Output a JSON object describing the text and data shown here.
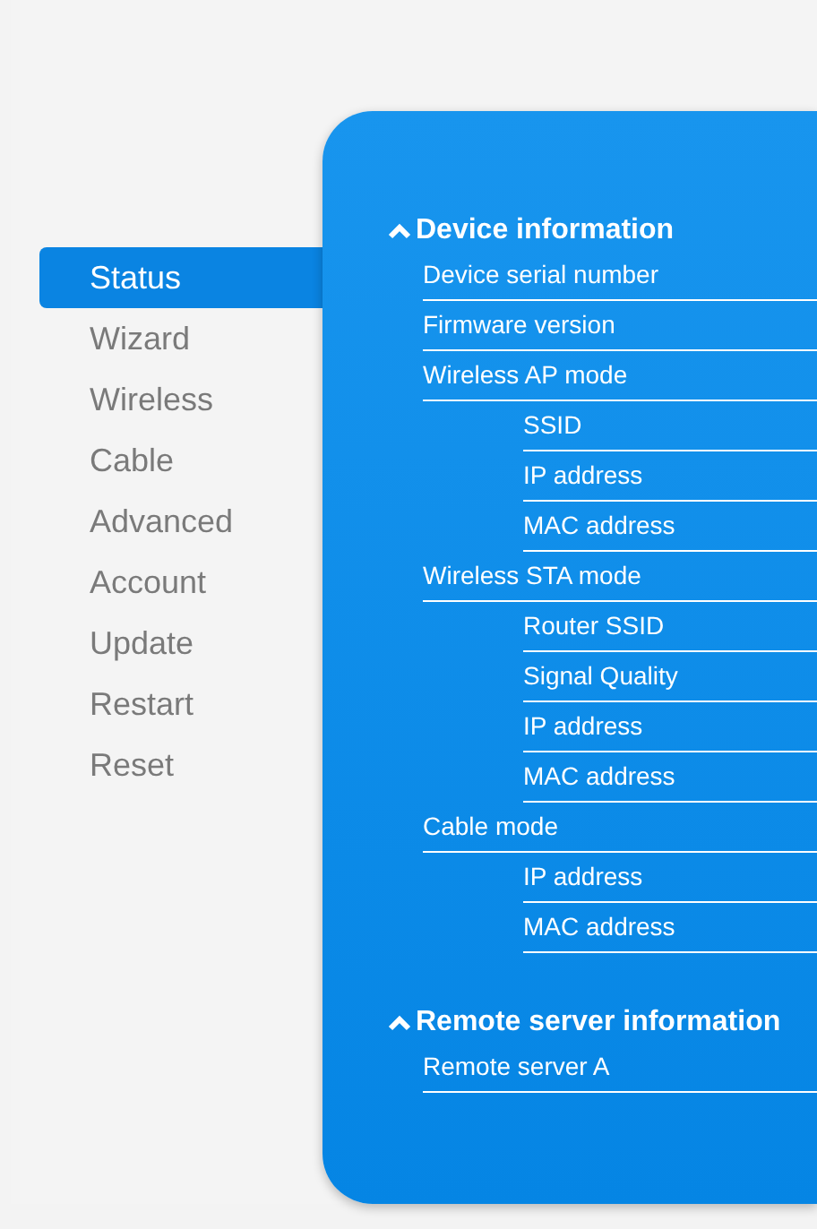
{
  "sidebar": {
    "items": [
      {
        "label": "Status",
        "selected": true
      },
      {
        "label": "Wizard",
        "selected": false
      },
      {
        "label": "Wireless",
        "selected": false
      },
      {
        "label": "Cable",
        "selected": false
      },
      {
        "label": "Advanced",
        "selected": false
      },
      {
        "label": "Account",
        "selected": false
      },
      {
        "label": "Update",
        "selected": false
      },
      {
        "label": "Restart",
        "selected": false
      },
      {
        "label": "Reset",
        "selected": false
      }
    ]
  },
  "sections": [
    {
      "title": "Device information",
      "expanded": true,
      "rows": [
        {
          "label": "Device serial number"
        },
        {
          "label": "Firmware version"
        },
        {
          "label": "Wireless AP mode",
          "children": [
            {
              "label": "SSID"
            },
            {
              "label": "IP address"
            },
            {
              "label": "MAC address"
            }
          ]
        },
        {
          "label": "Wireless STA mode",
          "children": [
            {
              "label": "Router SSID"
            },
            {
              "label": "Signal Quality"
            },
            {
              "label": "IP address"
            },
            {
              "label": "MAC address"
            }
          ]
        },
        {
          "label": "Cable mode",
          "children": [
            {
              "label": "IP address"
            },
            {
              "label": "MAC address"
            }
          ]
        }
      ]
    },
    {
      "title": "Remote server information",
      "expanded": true,
      "rows": [
        {
          "label": "Remote server A"
        }
      ]
    }
  ]
}
